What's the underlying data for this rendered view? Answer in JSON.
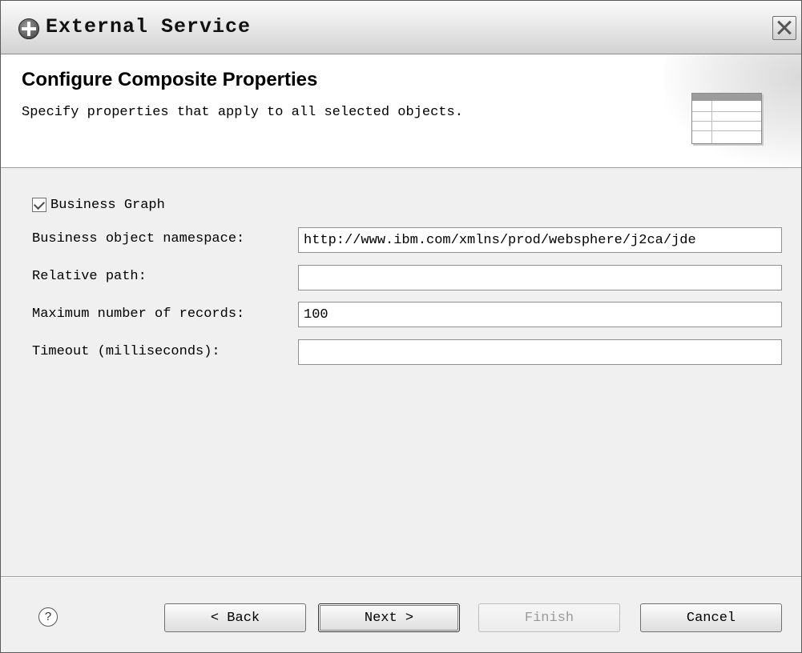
{
  "window": {
    "title": "External Service",
    "close_label": "Close"
  },
  "banner": {
    "title": "Configure Composite Properties",
    "description": "Specify properties that apply to all selected objects.",
    "icon": "table-icon"
  },
  "form": {
    "business_graph": {
      "label": "Business Graph",
      "checked": true
    },
    "fields": [
      {
        "label": "Business object namespace:",
        "value": "http://www.ibm.com/xmlns/prod/websphere/j2ca/jde"
      },
      {
        "label": "Relative path:",
        "value": ""
      },
      {
        "label": "Maximum number of records:",
        "value": "100"
      },
      {
        "label": "Timeout (milliseconds):",
        "value": ""
      }
    ]
  },
  "buttons": {
    "help": "?",
    "back": "< Back",
    "next": "Next >",
    "finish": "Finish",
    "cancel": "Cancel"
  }
}
